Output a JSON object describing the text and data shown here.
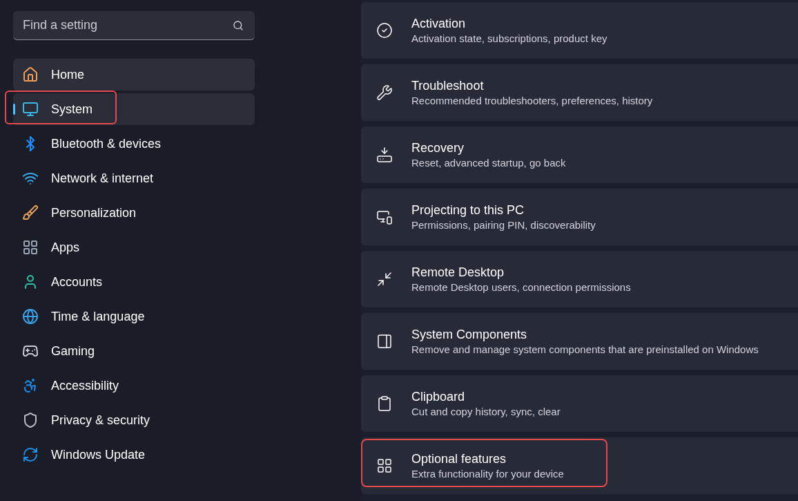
{
  "search": {
    "placeholder": "Find a setting"
  },
  "nav": [
    {
      "label": "Home",
      "selected": false,
      "hovered": true,
      "highlighted": false
    },
    {
      "label": "System",
      "selected": true,
      "hovered": false,
      "highlighted": true
    },
    {
      "label": "Bluetooth & devices",
      "selected": false,
      "hovered": false,
      "highlighted": false
    },
    {
      "label": "Network & internet",
      "selected": false,
      "hovered": false,
      "highlighted": false
    },
    {
      "label": "Personalization",
      "selected": false,
      "hovered": false,
      "highlighted": false
    },
    {
      "label": "Apps",
      "selected": false,
      "hovered": false,
      "highlighted": false
    },
    {
      "label": "Accounts",
      "selected": false,
      "hovered": false,
      "highlighted": false
    },
    {
      "label": "Time & language",
      "selected": false,
      "hovered": false,
      "highlighted": false
    },
    {
      "label": "Gaming",
      "selected": false,
      "hovered": false,
      "highlighted": false
    },
    {
      "label": "Accessibility",
      "selected": false,
      "hovered": false,
      "highlighted": false
    },
    {
      "label": "Privacy & security",
      "selected": false,
      "hovered": false,
      "highlighted": false
    },
    {
      "label": "Windows Update",
      "selected": false,
      "hovered": false,
      "highlighted": false
    }
  ],
  "settings": [
    {
      "title": "Activation",
      "description": "Activation state, subscriptions, product key",
      "highlighted": false
    },
    {
      "title": "Troubleshoot",
      "description": "Recommended troubleshooters, preferences, history",
      "highlighted": false
    },
    {
      "title": "Recovery",
      "description": "Reset, advanced startup, go back",
      "highlighted": false
    },
    {
      "title": "Projecting to this PC",
      "description": "Permissions, pairing PIN, discoverability",
      "highlighted": false
    },
    {
      "title": "Remote Desktop",
      "description": "Remote Desktop users, connection permissions",
      "highlighted": false
    },
    {
      "title": "System Components",
      "description": "Remove and manage system components that are preinstalled on Windows",
      "highlighted": false
    },
    {
      "title": "Clipboard",
      "description": "Cut and copy history, sync, clear",
      "highlighted": false
    },
    {
      "title": "Optional features",
      "description": "Extra functionality for your device",
      "highlighted": true
    }
  ]
}
